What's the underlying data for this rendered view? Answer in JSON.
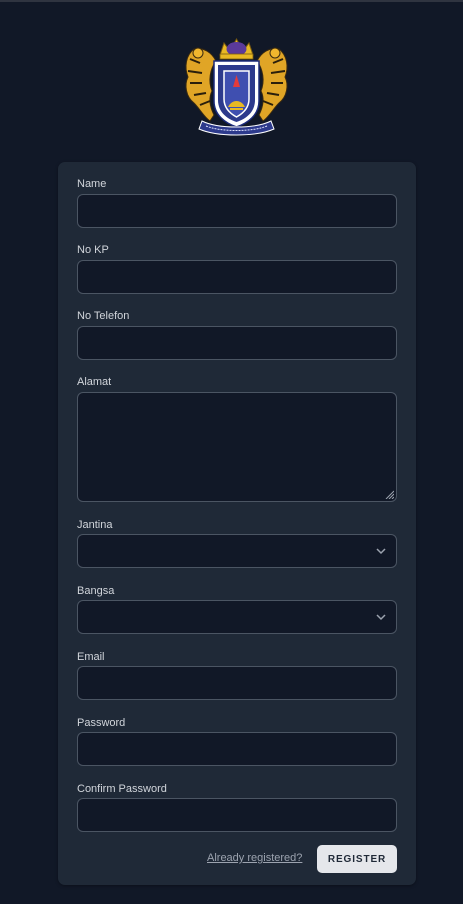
{
  "logo": {
    "name": "crest-logo-icon"
  },
  "form": {
    "fields": [
      {
        "label": "Name",
        "value": ""
      },
      {
        "label": "No KP",
        "value": ""
      },
      {
        "label": "No Telefon",
        "value": ""
      },
      {
        "label": "Alamat",
        "value": ""
      },
      {
        "label": "Jantina",
        "value": ""
      },
      {
        "label": "Bangsa",
        "value": ""
      },
      {
        "label": "Email",
        "value": ""
      },
      {
        "label": "Password",
        "value": ""
      },
      {
        "label": "Confirm Password",
        "value": ""
      }
    ],
    "already_registered": "Already registered?",
    "register_label": "REGISTER"
  },
  "colors": {
    "page_bg": "#111827",
    "card_bg": "#1f2937",
    "input_border": "#4b5563",
    "button_bg": "#e5e7eb",
    "crest_blue": "#2d3a8c",
    "crest_gold": "#e8b923"
  }
}
